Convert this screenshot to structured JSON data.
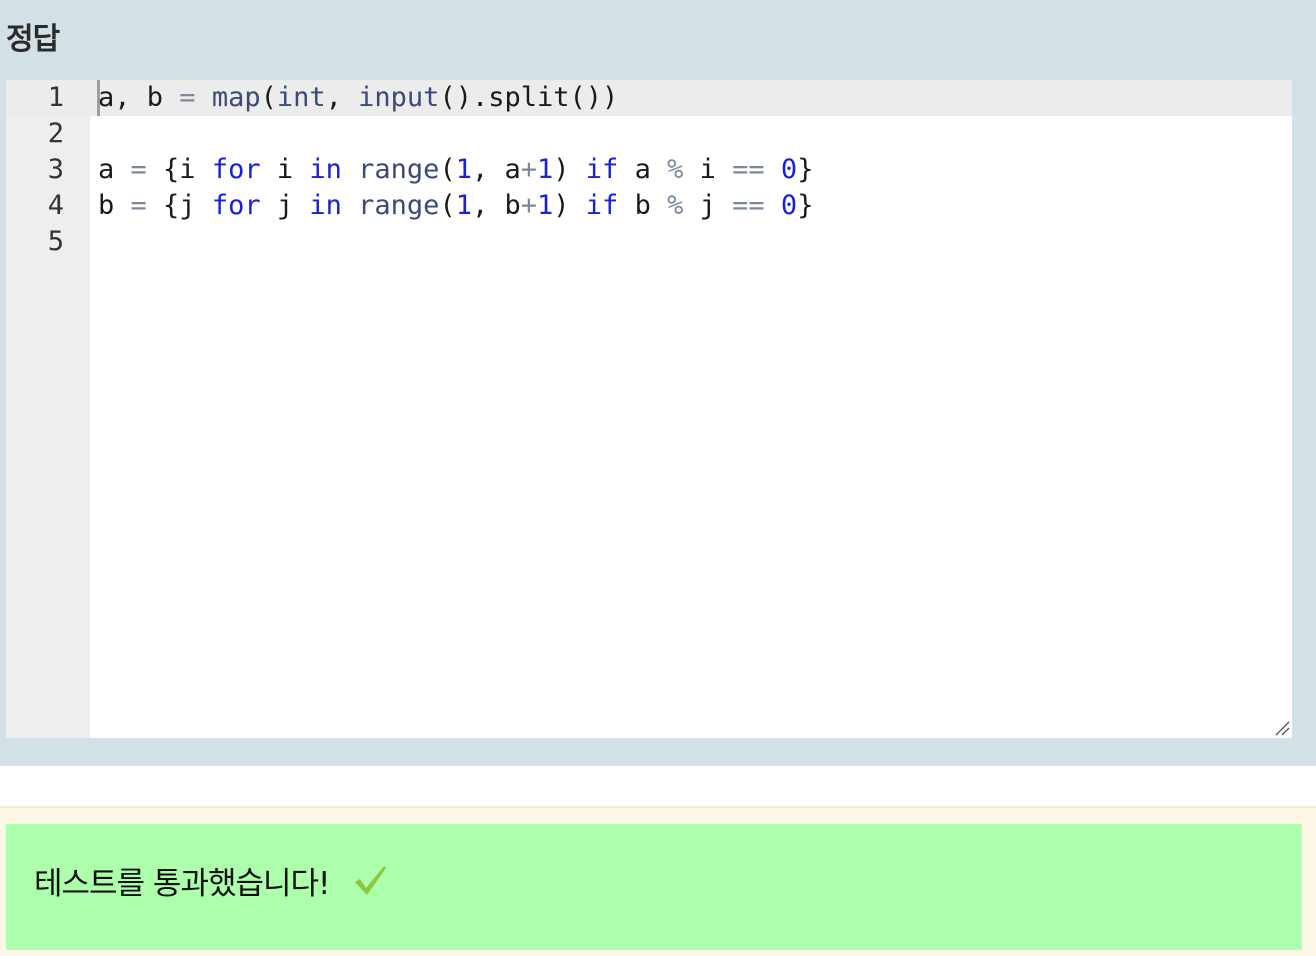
{
  "answer": {
    "title": "정답"
  },
  "editor": {
    "lines": [
      {
        "number": "1",
        "tokens": [
          {
            "t": "a, b ",
            "c": "plain"
          },
          {
            "t": "=",
            "c": "op"
          },
          {
            "t": " ",
            "c": "plain"
          },
          {
            "t": "map",
            "c": "builtin"
          },
          {
            "t": "(",
            "c": "plain"
          },
          {
            "t": "int",
            "c": "builtin"
          },
          {
            "t": ", ",
            "c": "plain"
          },
          {
            "t": "input",
            "c": "builtin"
          },
          {
            "t": "().split())",
            "c": "plain"
          }
        ]
      },
      {
        "number": "2",
        "tokens": []
      },
      {
        "number": "3",
        "tokens": [
          {
            "t": "a ",
            "c": "plain"
          },
          {
            "t": "=",
            "c": "op"
          },
          {
            "t": " {i ",
            "c": "plain"
          },
          {
            "t": "for",
            "c": "kw"
          },
          {
            "t": " i ",
            "c": "plain"
          },
          {
            "t": "in",
            "c": "kw"
          },
          {
            "t": " ",
            "c": "plain"
          },
          {
            "t": "range",
            "c": "builtin"
          },
          {
            "t": "(",
            "c": "plain"
          },
          {
            "t": "1",
            "c": "num"
          },
          {
            "t": ", a",
            "c": "plain"
          },
          {
            "t": "+",
            "c": "op"
          },
          {
            "t": "1",
            "c": "num"
          },
          {
            "t": ") ",
            "c": "plain"
          },
          {
            "t": "if",
            "c": "kw"
          },
          {
            "t": " a ",
            "c": "plain"
          },
          {
            "t": "%",
            "c": "op"
          },
          {
            "t": " i ",
            "c": "plain"
          },
          {
            "t": "==",
            "c": "op"
          },
          {
            "t": " ",
            "c": "plain"
          },
          {
            "t": "0",
            "c": "num"
          },
          {
            "t": "}",
            "c": "plain"
          }
        ]
      },
      {
        "number": "4",
        "tokens": [
          {
            "t": "b ",
            "c": "plain"
          },
          {
            "t": "=",
            "c": "op"
          },
          {
            "t": " {j ",
            "c": "plain"
          },
          {
            "t": "for",
            "c": "kw"
          },
          {
            "t": " j ",
            "c": "plain"
          },
          {
            "t": "in",
            "c": "kw"
          },
          {
            "t": " ",
            "c": "plain"
          },
          {
            "t": "range",
            "c": "builtin"
          },
          {
            "t": "(",
            "c": "plain"
          },
          {
            "t": "1",
            "c": "num"
          },
          {
            "t": ", b",
            "c": "plain"
          },
          {
            "t": "+",
            "c": "op"
          },
          {
            "t": "1",
            "c": "num"
          },
          {
            "t": ") ",
            "c": "plain"
          },
          {
            "t": "if",
            "c": "kw"
          },
          {
            "t": " b ",
            "c": "plain"
          },
          {
            "t": "%",
            "c": "op"
          },
          {
            "t": " j ",
            "c": "plain"
          },
          {
            "t": "==",
            "c": "op"
          },
          {
            "t": " ",
            "c": "plain"
          },
          {
            "t": "0",
            "c": "num"
          },
          {
            "t": "}",
            "c": "plain"
          }
        ]
      },
      {
        "number": "5",
        "tokens": []
      }
    ]
  },
  "result": {
    "message": "테스트를 통과했습니다!",
    "icon": "check-icon"
  },
  "colors": {
    "section_background": "#d3e0e6",
    "gutter": "#eeeeee",
    "active_line": "#ececec",
    "keyword": "#1a22d8",
    "operator": "#7b8a9b",
    "builtin": "#3b4a78",
    "result_box": "#adffac",
    "result_band": "#fdf7e8",
    "check": "#8cc63f"
  }
}
